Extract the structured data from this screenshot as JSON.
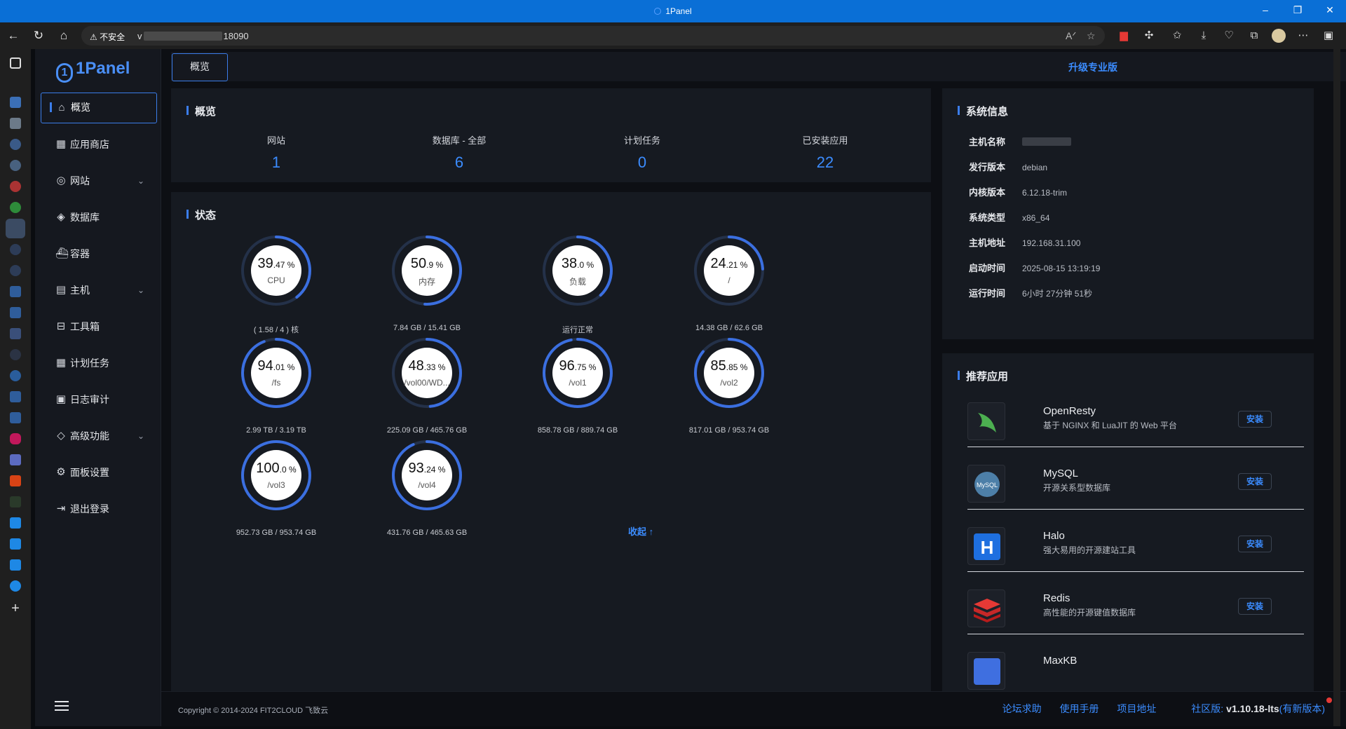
{
  "window": {
    "title": "1Panel"
  },
  "browser": {
    "warning": "不安全",
    "url_prefix": "v",
    "url_suffix": "18090"
  },
  "sidebar": {
    "logo": "1Panel",
    "items": [
      {
        "label": "概览",
        "icon": "home-icon",
        "glyph": "⌂"
      },
      {
        "label": "应用商店",
        "icon": "grid-icon",
        "glyph": "▦"
      },
      {
        "label": "网站",
        "icon": "globe-icon",
        "glyph": "◎"
      },
      {
        "label": "数据库",
        "icon": "layers-icon",
        "glyph": "◈"
      },
      {
        "label": "容器",
        "icon": "docker-icon",
        "glyph": "⛴"
      },
      {
        "label": "主机",
        "icon": "server-icon",
        "glyph": "▤"
      },
      {
        "label": "工具箱",
        "icon": "toolbox-icon",
        "glyph": "⊟"
      },
      {
        "label": "计划任务",
        "icon": "calendar-icon",
        "glyph": "▦"
      },
      {
        "label": "日志审计",
        "icon": "log-icon",
        "glyph": "▣"
      },
      {
        "label": "高级功能",
        "icon": "diamond-icon",
        "glyph": "◇"
      },
      {
        "label": "面板设置",
        "icon": "gear-icon",
        "glyph": "⚙"
      },
      {
        "label": "退出登录",
        "icon": "logout-icon",
        "glyph": "⇥"
      }
    ]
  },
  "topbar": {
    "tab": "概览",
    "upgrade": "升级专业版"
  },
  "overview": {
    "title": "概览",
    "stats": [
      {
        "label": "网站",
        "value": "1"
      },
      {
        "label": "数据库 - 全部",
        "value": "6"
      },
      {
        "label": "计划任务",
        "value": "0"
      },
      {
        "label": "已安装应用",
        "value": "22"
      }
    ]
  },
  "status": {
    "title": "状态",
    "gauges": [
      {
        "int": "39",
        "dec": ".47 %",
        "label": "CPU",
        "foot": "( 1.58 / 4 ) 核",
        "percent": 39.47
      },
      {
        "int": "50",
        "dec": ".9 %",
        "label": "内存",
        "foot": "7.84 GB / 15.41 GB",
        "percent": 50.9
      },
      {
        "int": "38",
        "dec": ".0 %",
        "label": "负载",
        "foot": "运行正常",
        "percent": 38.0
      },
      {
        "int": "24",
        "dec": ".21 %",
        "label": "/",
        "foot": "14.38 GB / 62.6 GB",
        "percent": 24.21
      },
      {
        "int": "94",
        "dec": ".01 %",
        "label": "/fs",
        "foot": "2.99 TB / 3.19 TB",
        "percent": 94.01
      },
      {
        "int": "48",
        "dec": ".33 %",
        "label": "/vol00/WD...",
        "foot": "225.09 GB / 465.76 GB",
        "percent": 48.33
      },
      {
        "int": "96",
        "dec": ".75 %",
        "label": "/vol1",
        "foot": "858.78 GB / 889.74 GB",
        "percent": 96.75
      },
      {
        "int": "85",
        "dec": ".85 %",
        "label": "/vol2",
        "foot": "817.01 GB / 953.74 GB",
        "percent": 85.85
      },
      {
        "int": "100",
        "dec": ".0 %",
        "label": "/vol3",
        "foot": "952.73 GB / 953.74 GB",
        "percent": 100.0
      },
      {
        "int": "93",
        "dec": ".24 %",
        "label": "/vol4",
        "foot": "431.76 GB / 465.63 GB",
        "percent": 93.24
      }
    ],
    "collapse": "收起 ↑"
  },
  "sysinfo": {
    "title": "系统信息",
    "rows": [
      {
        "k": "主机名称",
        "v": ""
      },
      {
        "k": "发行版本",
        "v": "debian"
      },
      {
        "k": "内核版本",
        "v": "6.12.18-trim"
      },
      {
        "k": "系统类型",
        "v": "x86_64"
      },
      {
        "k": "主机地址",
        "v": "192.168.31.100"
      },
      {
        "k": "启动时间",
        "v": "2025-08-15 13:19:19"
      },
      {
        "k": "运行时间",
        "v": "6小时 27分钟 51秒"
      }
    ]
  },
  "recommend": {
    "title": "推荐应用",
    "apps": [
      {
        "name": "OpenResty",
        "desc": "基于 NGINX 和 LuaJIT 的 Web 平台",
        "btn": "安装"
      },
      {
        "name": "MySQL",
        "desc": "开源关系型数据库",
        "btn": "安装"
      },
      {
        "name": "Halo",
        "desc": "强大易用的开源建站工具",
        "btn": "安装"
      },
      {
        "name": "Redis",
        "desc": "高性能的开源键值数据库",
        "btn": "安装"
      },
      {
        "name": "MaxKB",
        "desc": "",
        "btn": ""
      }
    ]
  },
  "footer": {
    "copyright": "Copyright © 2014-2024 FIT2CLOUD 飞致云",
    "links": [
      "论坛求助",
      "使用手册",
      "项目地址"
    ],
    "edition": "社区版:",
    "version": "v1.10.18-lts",
    "update": "(有新版本)"
  },
  "colors": {
    "accent": "#3b8cff",
    "gauge_track": "#243149",
    "gauge_fill": "#3b6fe0"
  }
}
